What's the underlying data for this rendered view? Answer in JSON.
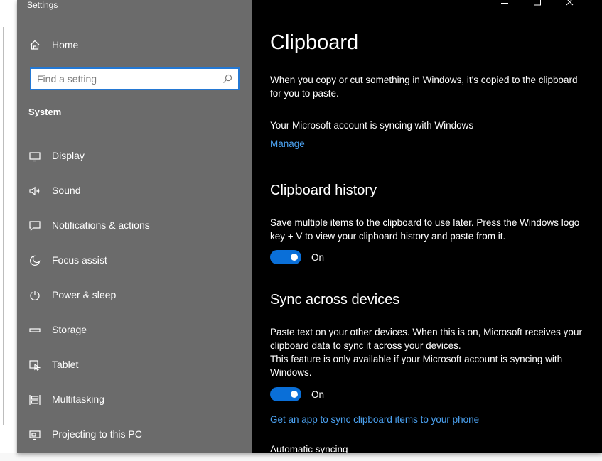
{
  "window": {
    "title": "Settings"
  },
  "sidebar": {
    "home_label": "Home",
    "search_placeholder": "Find a setting",
    "section_heading": "System",
    "items": [
      {
        "label": "Display",
        "icon": "display-icon"
      },
      {
        "label": "Sound",
        "icon": "speaker-icon"
      },
      {
        "label": "Notifications & actions",
        "icon": "notification-icon"
      },
      {
        "label": "Focus assist",
        "icon": "moon-icon"
      },
      {
        "label": "Power & sleep",
        "icon": "power-icon"
      },
      {
        "label": "Storage",
        "icon": "storage-icon"
      },
      {
        "label": "Tablet",
        "icon": "tablet-icon"
      },
      {
        "label": "Multitasking",
        "icon": "multitasking-icon"
      },
      {
        "label": "Projecting to this PC",
        "icon": "projecting-icon"
      }
    ]
  },
  "main": {
    "title": "Clipboard",
    "intro": "When you copy or cut something in Windows, it's copied to the clipboard for you to paste.",
    "account_status": "Your Microsoft account is syncing with Windows",
    "manage_link": "Manage",
    "history": {
      "heading": "Clipboard history",
      "description": "Save multiple items to the clipboard to use later. Press the Windows logo key + V to view your clipboard history and paste from it.",
      "toggle_label": "On",
      "toggle_on": true
    },
    "sync": {
      "heading": "Sync across devices",
      "description": "Paste text on your other devices. When this is on, Microsoft receives your clipboard data to sync it across your devices.",
      "note": "This feature is only available if your Microsoft account is syncing with Windows.",
      "toggle_label": "On",
      "toggle_on": true,
      "phone_link": "Get an app to sync clipboard items to your phone",
      "automatic_syncing": "Automatic syncing"
    }
  },
  "colors": {
    "sidebar_bg": "#6b6b6b",
    "main_bg": "#000000",
    "accent": "#0a6fd8",
    "link": "#4ba1f0"
  }
}
